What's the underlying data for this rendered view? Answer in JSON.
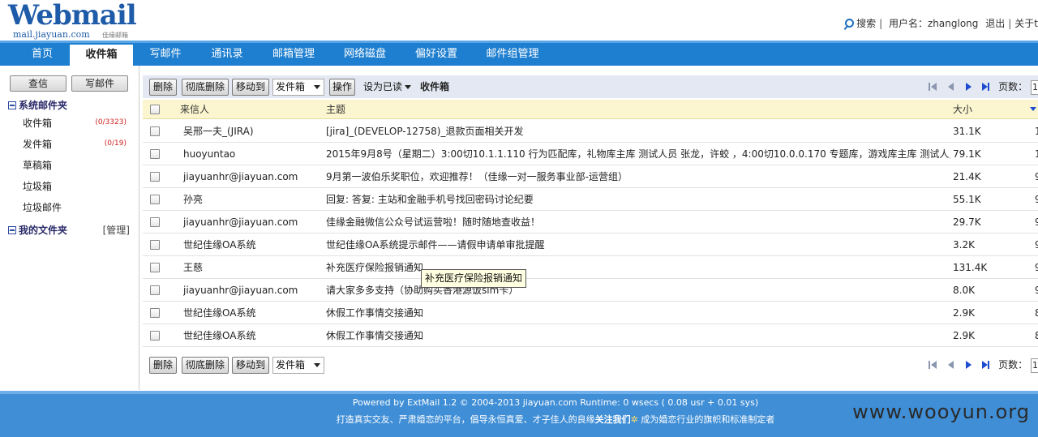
{
  "logo": {
    "title": "Webmail",
    "domain": "mail.jiayuan.com",
    "tagline": "佳缘邮箱"
  },
  "top": {
    "search": "搜索",
    "user_label": "用户名：zhanglong",
    "logout": "退出",
    "about": "关于t"
  },
  "nav": [
    {
      "label": "首页"
    },
    {
      "label": "收件箱",
      "active": true
    },
    {
      "label": "写邮件"
    },
    {
      "label": "通讯录"
    },
    {
      "label": "邮箱管理"
    },
    {
      "label": "网络磁盘"
    },
    {
      "label": "偏好设置"
    },
    {
      "label": "邮件组管理"
    }
  ],
  "sidebar": {
    "check_button": "查信",
    "compose_button": "写邮件",
    "system_folders_title": "系统邮件夹",
    "folders": [
      {
        "label": "收件箱",
        "count": "(0/3323)"
      },
      {
        "label": "发件箱",
        "count": "(0/19)"
      },
      {
        "label": "草稿箱",
        "count": ""
      },
      {
        "label": "垃圾箱",
        "count": ""
      },
      {
        "label": "垃圾邮件",
        "count": ""
      }
    ],
    "my_folders_title": "我的文件夹",
    "manage": "[管理]"
  },
  "toolbar": {
    "delete": "删除",
    "purge": "彻底删除",
    "move_to": "移动到",
    "move_target": "发件箱",
    "operate": "操作",
    "mark_as": "设为已读",
    "folder_name": "收件箱",
    "page_label": "页数：",
    "page_value": "1"
  },
  "table": {
    "headers": {
      "from": "来信人",
      "subject": "主题",
      "size": "大小"
    },
    "rows": [
      {
        "from": "吴邢一夫_(JIRA)",
        "subject": "[jira]_(DEVELOP-12758)_退款页面相关开发",
        "size": "31.1K",
        "date": "1"
      },
      {
        "from": "huoyuntao",
        "subject": " 2015年9月8号（星期二）3:00切10.1.1.110  行为匹配库，礼物库主库   测试人员 张龙，许蛟 ，4:00切10.0.0.170  专题库，游戏库主库  测试人员",
        "size": "79.1K",
        "date": "1"
      },
      {
        "from": "jiayuanhr@jiayuan.com",
        "subject": "9月第一波伯乐奖职位，欢迎推荐！（佳缘一对一服务事业部-运营组）",
        "size": "21.4K",
        "date": "9"
      },
      {
        "from": "孙亮",
        "subject": "回复: 答复: 主站和金融手机号找回密码讨论纪要",
        "size": "55.1K",
        "date": "9"
      },
      {
        "from": "jiayuanhr@jiayuan.com",
        "subject": "佳缘金融微信公众号试运营啦！随时随地查收益！",
        "size": "29.7K",
        "date": "9"
      },
      {
        "from": "世纪佳缘OA系统",
        "subject": "世纪佳缘OA系统提示邮件——请假申请单审批提醒",
        "size": "3.2K",
        "date": "9"
      },
      {
        "from": "王慈",
        "subject": "补充医疗保险报销通知",
        "size": "131.4K",
        "date": "9"
      },
      {
        "from": "jiayuanhr@jiayuan.com",
        "subject": "请大家多多支持（协助购买香港源饭sim卡）",
        "size": "8.0K",
        "date": "9"
      },
      {
        "from": "世纪佳缘OA系统",
        "subject": "休假工作事情交接通知",
        "size": "2.9K",
        "date": "8"
      },
      {
        "from": "世纪佳缘OA系统",
        "subject": "休假工作事情交接通知",
        "size": "2.9K",
        "date": "8"
      }
    ]
  },
  "tooltip": "补充医疗保险报销通知",
  "footer": {
    "powered": "Powered by ExtMail 1.2 © 2004-2013 jiayuan.com Runtime: 0 wsecs ( 0.08 usr + 0.01 sys)",
    "slogan_a": "打造真实交友、严肃婚恋的平台，倡导永恒真爱、才子佳人的良缘",
    "slogan_b": "关注我们",
    "slogan_c": " 成为婚恋行业的旗帜和标准制定者"
  },
  "watermark": "www.wooyun.org",
  "colors": {
    "nav": "#1e7fd0",
    "footer": "#3f8ed6",
    "header_row": "#fbf6cf",
    "toolbar": "#e3e8f2"
  }
}
